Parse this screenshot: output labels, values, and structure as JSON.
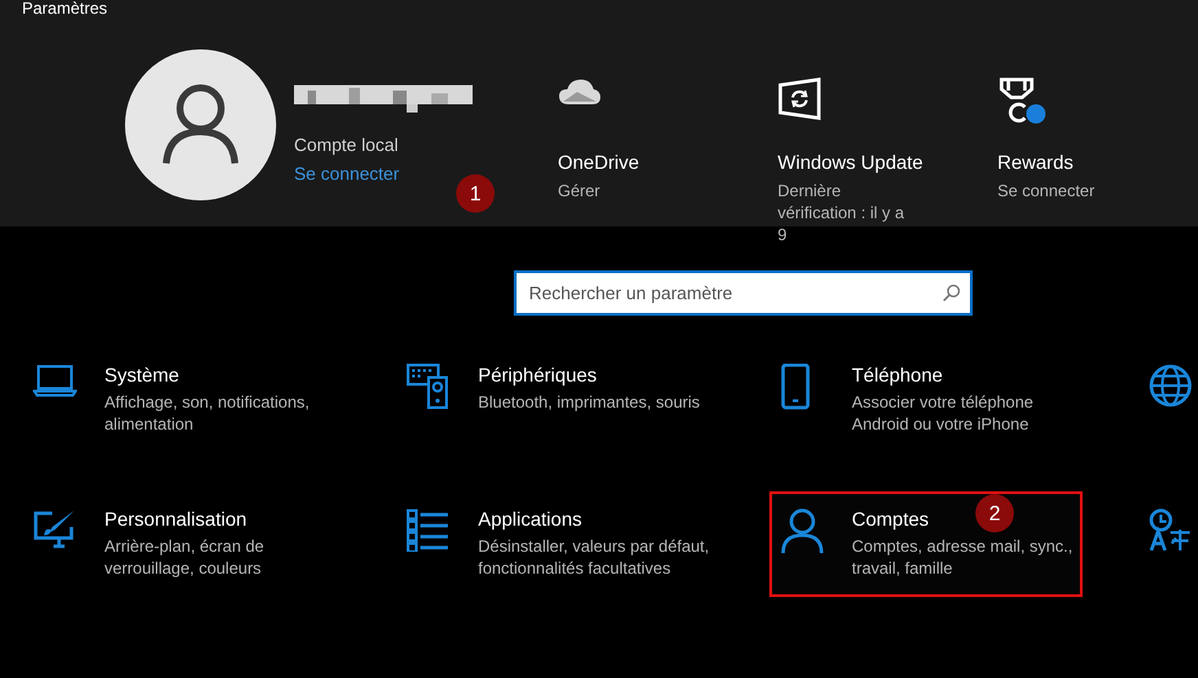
{
  "window": {
    "title": "Paramètres"
  },
  "account": {
    "type": "Compte local",
    "link": "Se connecter",
    "badge": "1"
  },
  "quick_links": [
    {
      "title": "OneDrive",
      "subtitle": "Gérer"
    },
    {
      "title": "Windows Update",
      "subtitle": "Dernière vérification : il y a 9"
    },
    {
      "title": "Rewards",
      "subtitle": "Se connecter"
    }
  ],
  "search": {
    "placeholder": "Rechercher un paramètre"
  },
  "categories": [
    {
      "title": "Système",
      "description": "Affichage, son, notifications, alimentation",
      "highlighted": false
    },
    {
      "title": "Périphériques",
      "description": "Bluetooth, imprimantes, souris",
      "highlighted": false
    },
    {
      "title": "Téléphone",
      "description": "Associer votre téléphone Android ou votre iPhone",
      "highlighted": false
    },
    {
      "highlighted": false
    },
    {
      "title": "Personnalisation",
      "description": "Arrière-plan, écran de verrouillage, couleurs",
      "highlighted": false
    },
    {
      "title": "Applications",
      "description": "Désinstaller, valeurs par défaut, fonctionnalités facultatives",
      "highlighted": false
    },
    {
      "title": "Comptes",
      "description": "Comptes, adresse mail, sync., travail, famille",
      "highlighted": true,
      "badge": "2"
    },
    {
      "highlighted": false
    }
  ]
}
